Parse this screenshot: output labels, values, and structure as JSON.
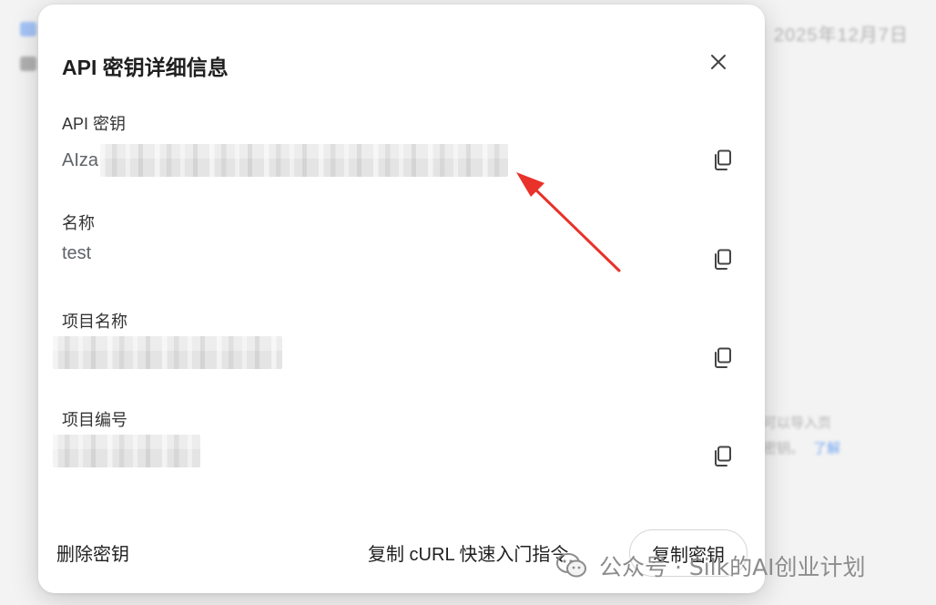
{
  "background": {
    "date": "2025年12月7日",
    "hint_line1": "可以导入页",
    "hint_line2": "密钥。",
    "learn_more": "了解"
  },
  "dialog": {
    "title": "API 密钥详细信息",
    "close_icon": "close-icon",
    "fields": [
      {
        "label": "API 密钥",
        "value_prefix": "AIza",
        "redacted": true
      },
      {
        "label": "名称",
        "value": "test",
        "redacted": false
      },
      {
        "label": "项目名称",
        "redacted": true
      },
      {
        "label": "项目编号",
        "redacted": true
      }
    ],
    "copy_icon": "copy-icon",
    "footer": {
      "delete_label": "删除密钥",
      "curl_label": "复制 cURL 快速入门指令",
      "copy_key_label": "复制密钥"
    }
  },
  "annotation": {
    "arrow_color": "#e8322a"
  },
  "watermark": {
    "text": "公众号 · Silk的AI创业计划",
    "icon": "wechat-icon"
  }
}
